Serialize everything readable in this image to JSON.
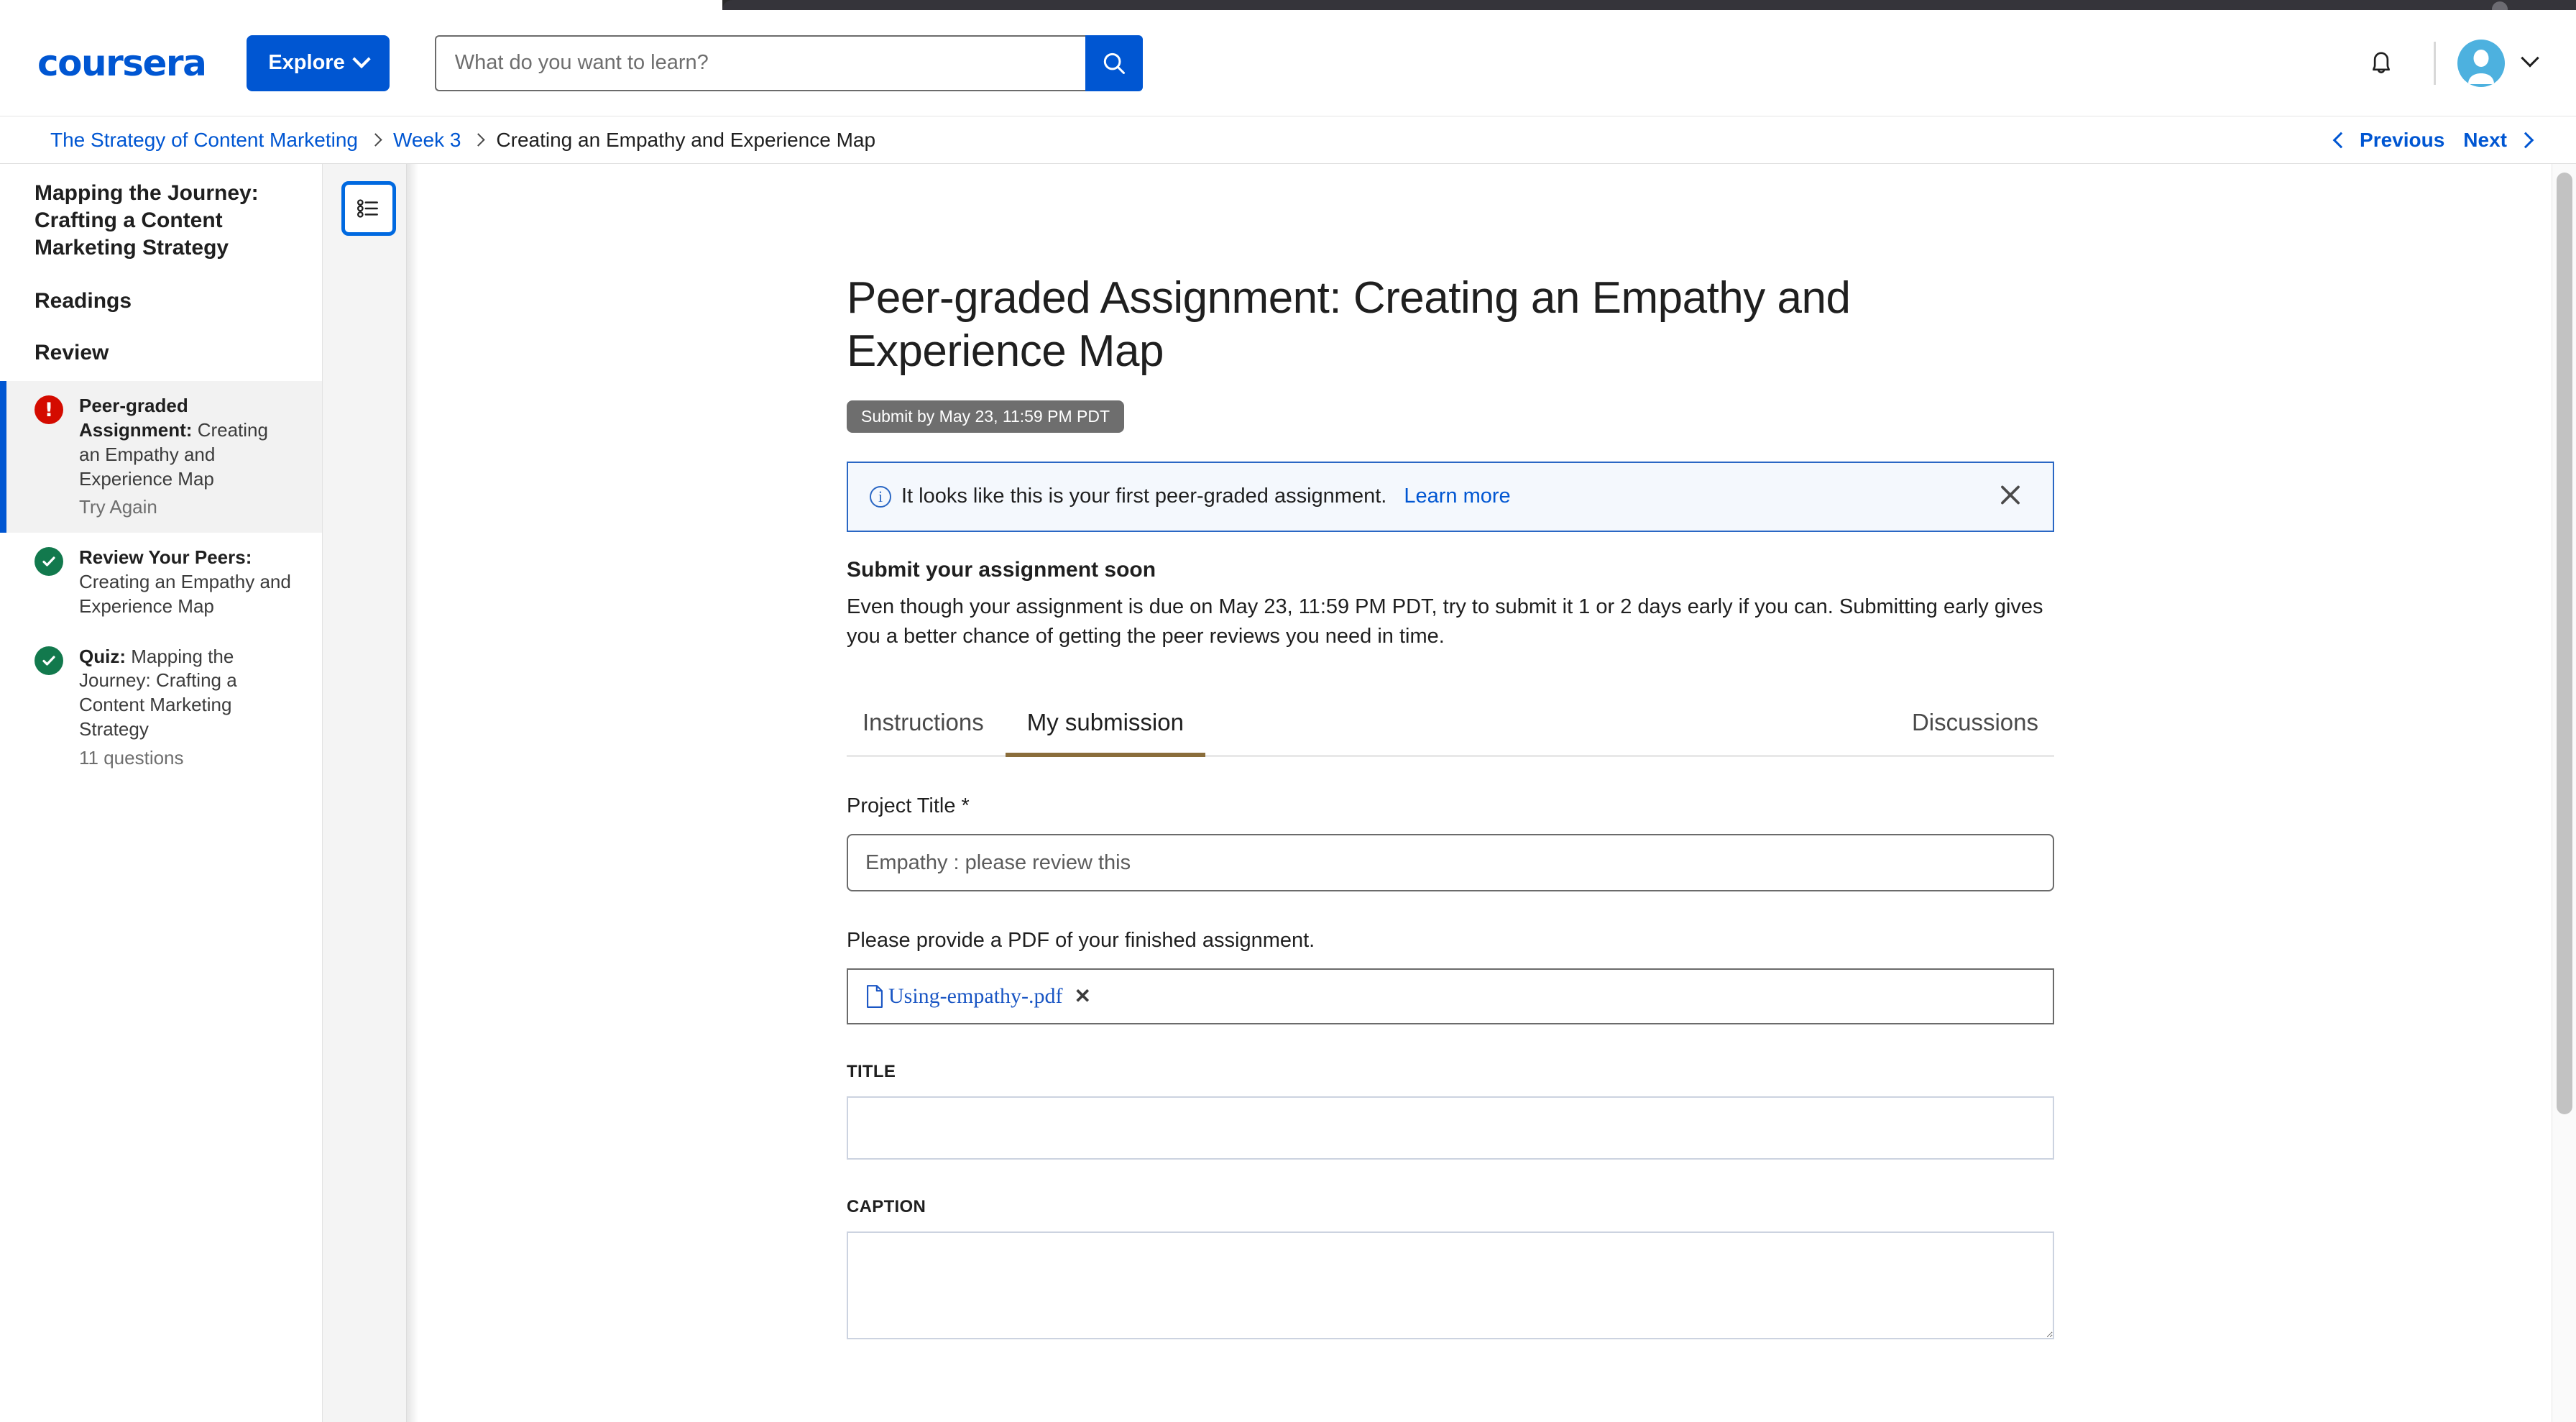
{
  "header": {
    "logo_text": "coursera",
    "explore_label": "Explore",
    "search": {
      "placeholder": "What do you want to learn?",
      "value": ""
    },
    "notification_icon": "bell-icon",
    "avatar_icon": "user-avatar-icon",
    "brand_color": "#0056D2",
    "avatar_color": "#4DB1DF"
  },
  "breadcrumb": {
    "items": [
      {
        "label": "The Strategy of Content Marketing",
        "current": false
      },
      {
        "label": "Week 3",
        "current": false
      },
      {
        "label": "Creating an Empathy and Experience Map",
        "current": true
      }
    ],
    "previous_label": "Previous",
    "next_label": "Next"
  },
  "sidebar": {
    "heading": "Mapping the Journey: Crafting a Content Marketing Strategy",
    "sections": [
      "Readings",
      "Review"
    ],
    "items": [
      {
        "title_bold": "Peer-graded Assignment:",
        "title_rest": " Creating an Empathy and Experience Map",
        "sub": "Try Again",
        "status": "error",
        "active": true
      },
      {
        "title_bold": "Review Your Peers:",
        "title_rest": " Creating an Empathy and Experience Map",
        "sub": "",
        "status": "complete",
        "active": false
      },
      {
        "title_bold": "Quiz:",
        "title_rest": " Mapping the Journey: Crafting a Content Marketing Strategy",
        "sub": "11 questions",
        "status": "complete",
        "active": false
      }
    ],
    "outline_toggle_icon": "list-outline-icon"
  },
  "main": {
    "title": "Peer-graded Assignment: Creating an Empathy and Experience Map",
    "due_badge": "Submit by May 23, 11:59 PM PDT",
    "banner": {
      "icon": "info-circle-icon",
      "text": "It looks like this is your first peer-graded assignment.",
      "link": "Learn more",
      "close_icon": "close-icon"
    },
    "notice": {
      "heading": "Submit your assignment soon",
      "body": "Even though your assignment is due on May 23, 11:59 PM PDT, try to submit it 1 or 2 days early if you can. Submitting early gives you a better chance of getting the peer reviews you need in time."
    },
    "tabs": [
      {
        "label": "Instructions",
        "active": false
      },
      {
        "label": "My submission",
        "active": true
      },
      {
        "label": "Discussions",
        "active": false
      }
    ],
    "active_tab_underline_color": "#8a6d3b",
    "form": {
      "project_title_label": "Project Title *",
      "project_title_placeholder": "Empathy : please review this",
      "project_title_value": "",
      "pdf_prompt": "Please provide a PDF of your finished assignment.",
      "file": {
        "name": "Using-empathy-.pdf",
        "icon": "document-icon",
        "remove_icon": "remove-file-icon"
      },
      "title_label": "TITLE",
      "title_value": "",
      "caption_label": "CAPTION",
      "caption_value": ""
    }
  }
}
